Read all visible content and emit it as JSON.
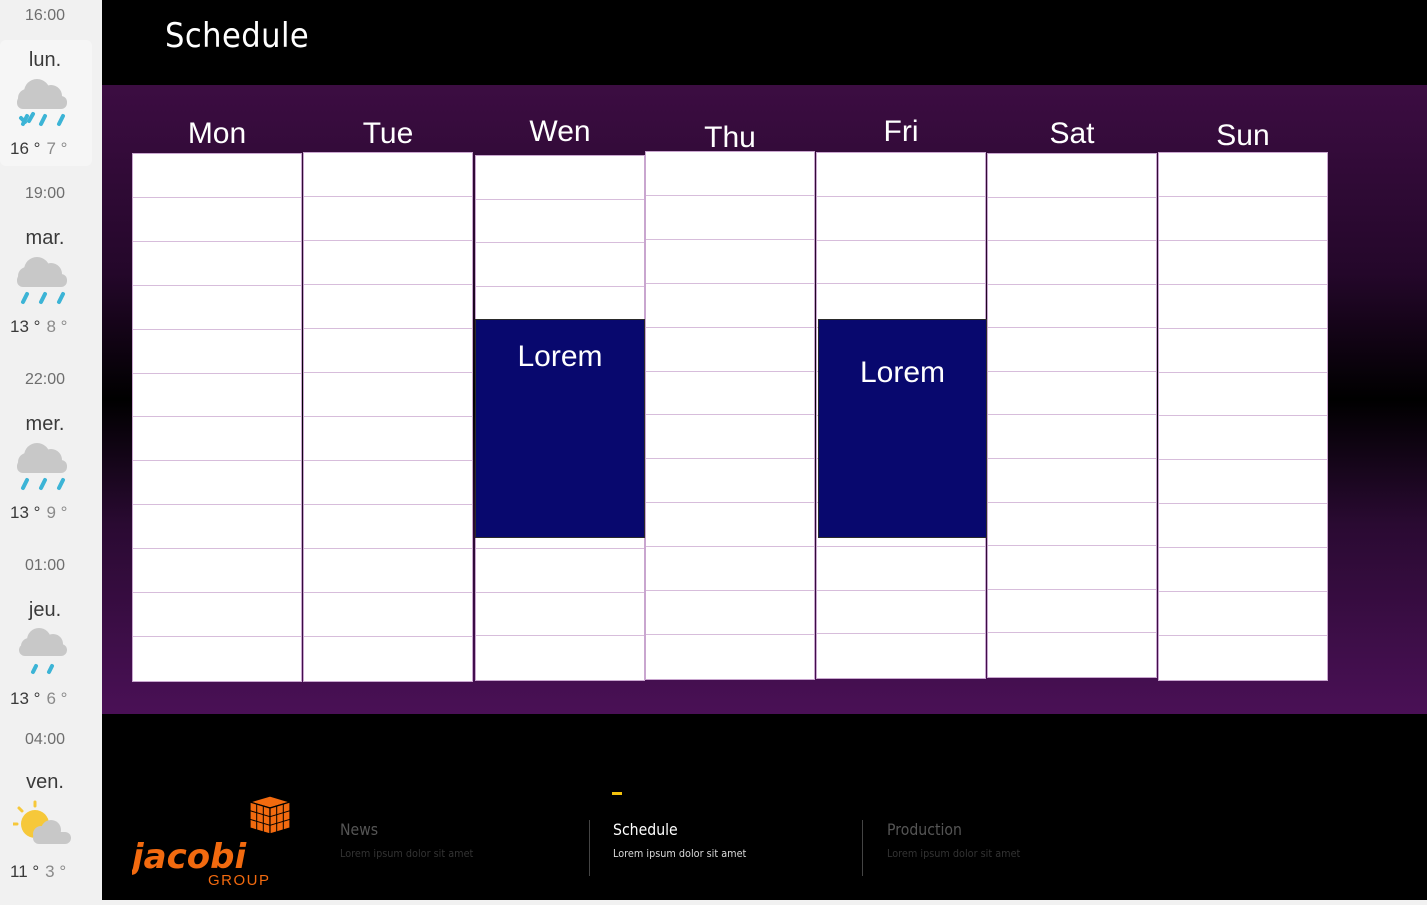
{
  "weather": {
    "slots": [
      {
        "time": "16:00",
        "day": "lun.",
        "high": "16 °",
        "low": "7 °",
        "icon": "rain-cloud-icon"
      },
      {
        "time": "19:00",
        "day": "mar.",
        "high": "13 °",
        "low": "8 °",
        "icon": "rain-cloud-icon"
      },
      {
        "time": "22:00",
        "day": "mer.",
        "high": "13 °",
        "low": "9 °",
        "icon": "rain-cloud-icon"
      },
      {
        "time": "01:00",
        "day": "jeu.",
        "high": "13 °",
        "low": "6 °",
        "icon": "light-rain-cloud-icon"
      },
      {
        "time": "04:00",
        "day": "ven.",
        "high": "11 °",
        "low": "3 °",
        "icon": "partly-sunny-icon"
      }
    ]
  },
  "header": {
    "title": "Schedule"
  },
  "calendar": {
    "days": [
      "Mon",
      "Tue",
      "Wen",
      "Thu",
      "Fri",
      "Sat",
      "Sun"
    ],
    "slots_per_day": 12,
    "events": [
      {
        "day": "Wen",
        "label": "Lorem"
      },
      {
        "day": "Fri",
        "label": "Lorem"
      }
    ]
  },
  "footer": {
    "logo_text": "jacobi",
    "logo_sub": "GROUP",
    "nav": [
      {
        "title": "News",
        "subtitle": "Lorem ipsum dolor sit amet",
        "active": false
      },
      {
        "title": "Schedule",
        "subtitle": "Lorem ipsum dolor sit amet",
        "active": true
      },
      {
        "title": "Production",
        "subtitle": "Lorem ipsum dolor sit amet",
        "active": false
      }
    ]
  },
  "colors": {
    "accent": "#f4c20d",
    "event": "#08086e",
    "logo": "#f26a0f",
    "rain": "#3cb4d6"
  }
}
